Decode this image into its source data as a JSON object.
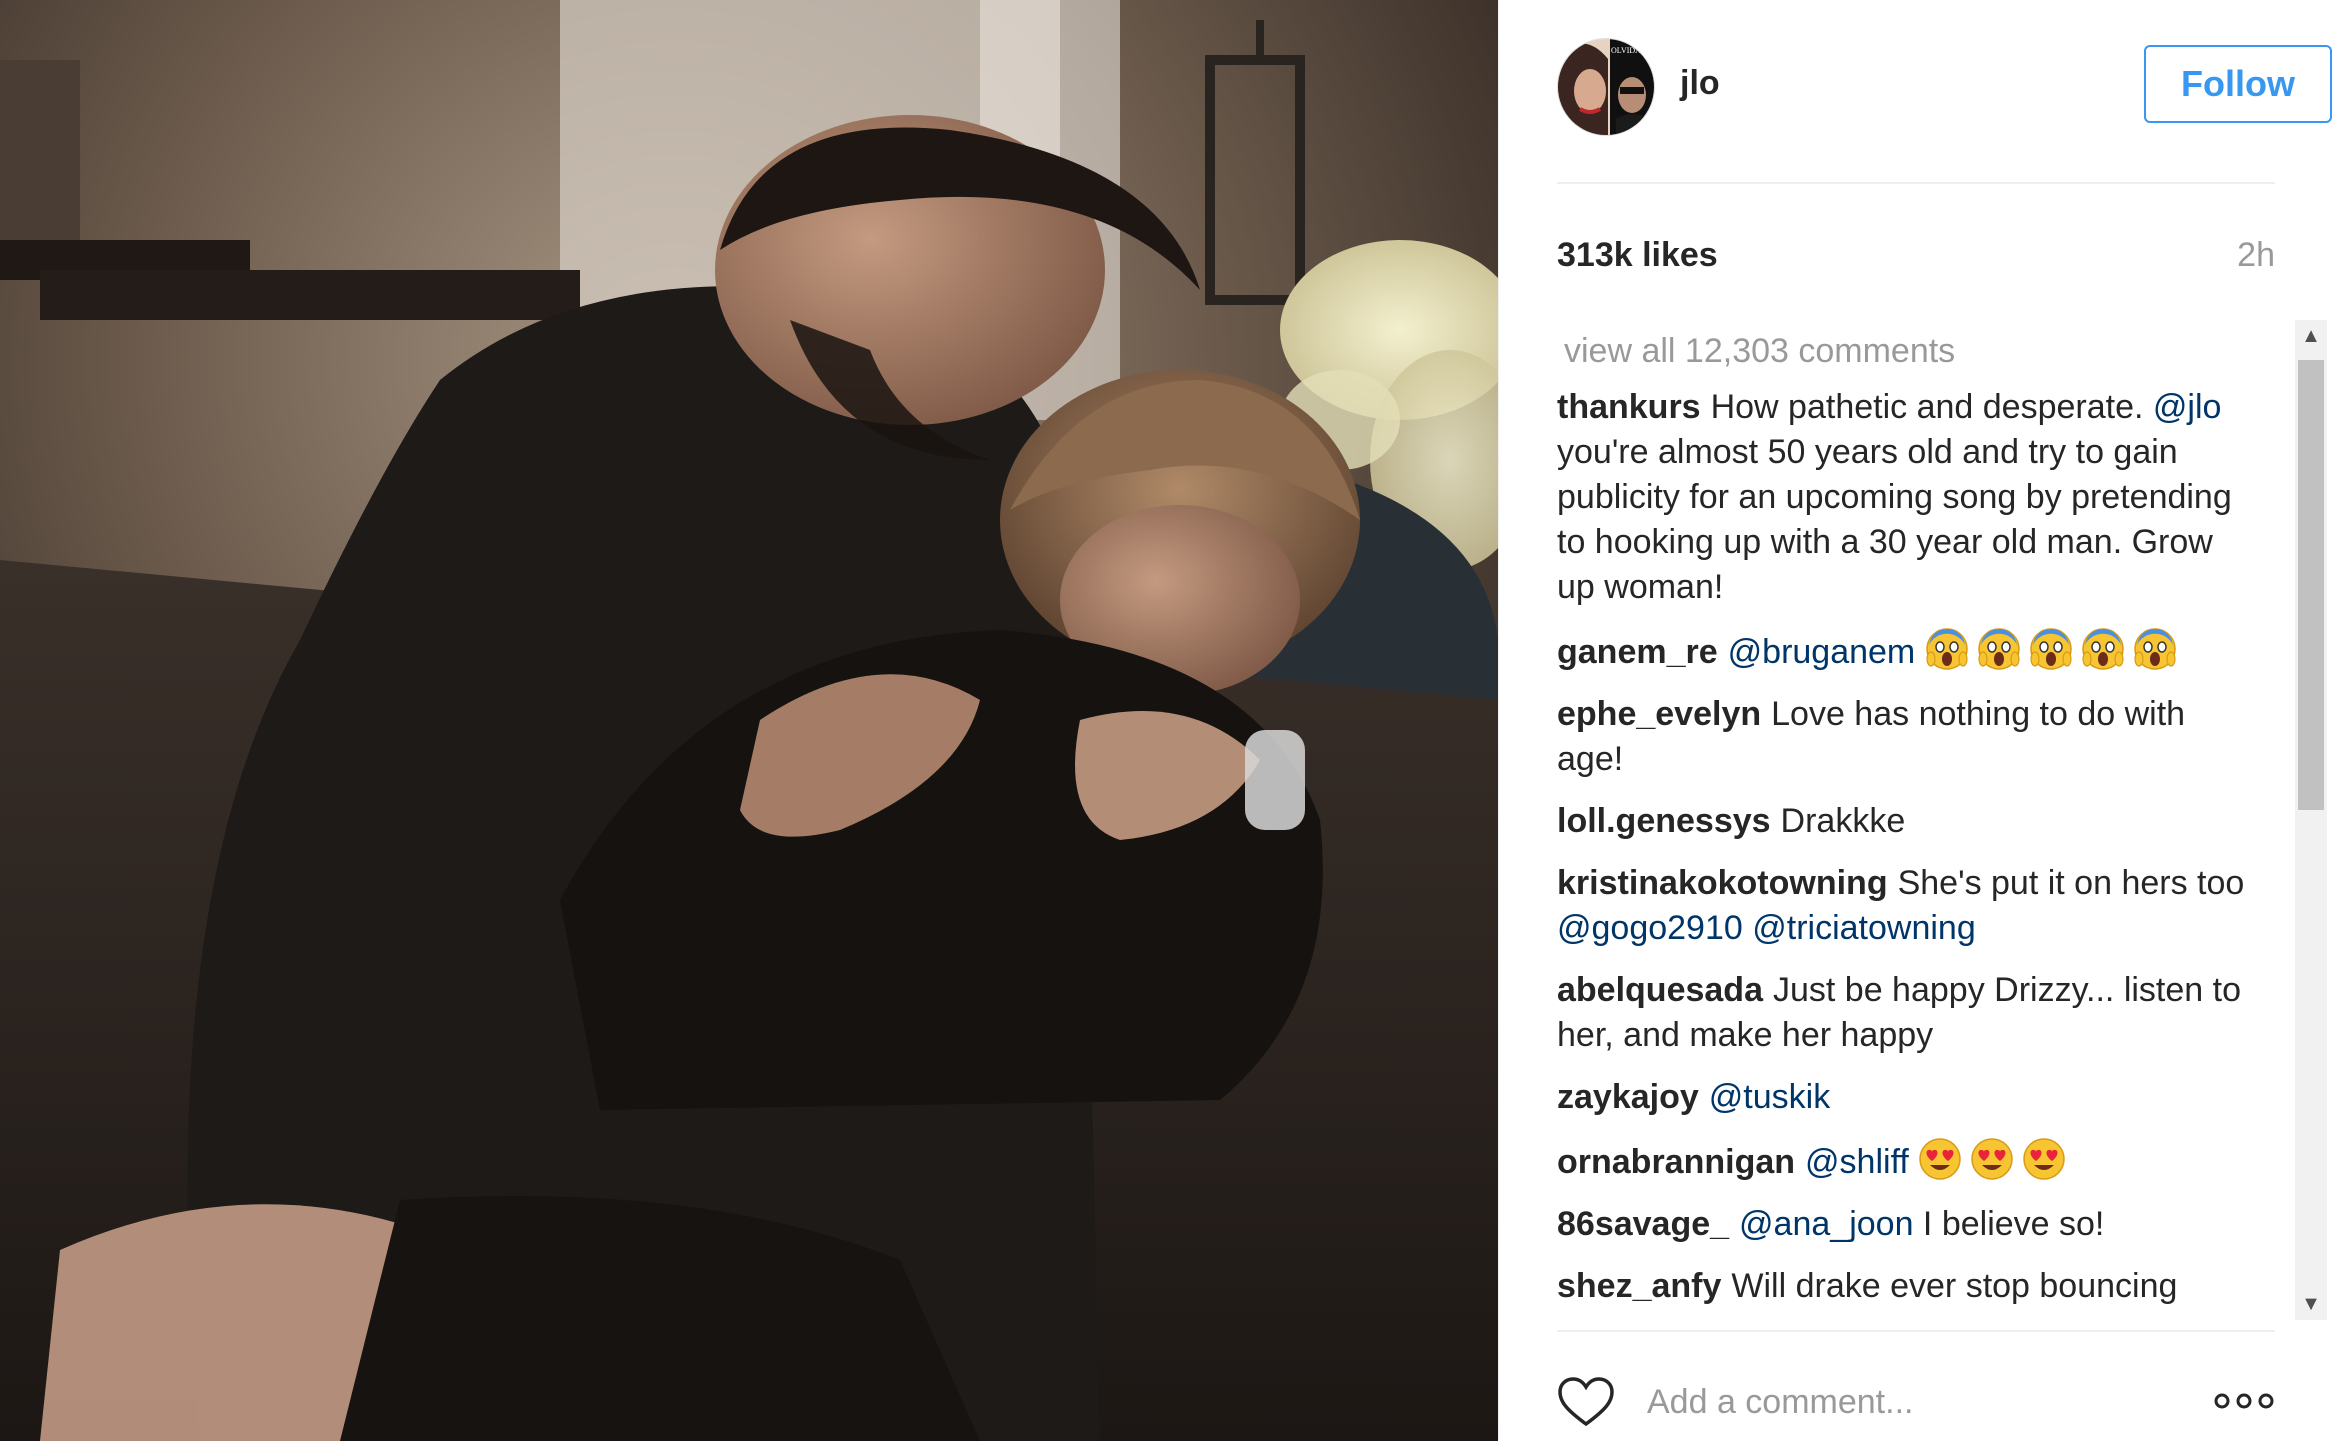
{
  "post": {
    "username": "jlo",
    "follow_label": "Follow",
    "likes": "313k likes",
    "time_ago": "2h",
    "view_all": "view all 12,303 comments",
    "add_comment_placeholder": "Add a comment...",
    "avatar_overlay_text": "OLVIDAME"
  },
  "comments": [
    {
      "user": "thankurs",
      "parts": [
        {
          "t": "text",
          "v": "How pathetic and desperate. "
        },
        {
          "t": "mention",
          "v": "@jlo"
        },
        {
          "t": "text",
          "v": " you're almost 50 years old and try to gain publicity for an upcoming song by pretending to hooking up with a 30 year old man. Grow up woman!"
        }
      ]
    },
    {
      "user": "ganem_re",
      "parts": [
        {
          "t": "mention",
          "v": "@bruganem"
        },
        {
          "t": "text",
          "v": " "
        },
        {
          "t": "emoji",
          "v": "scream"
        },
        {
          "t": "emoji",
          "v": "scream"
        },
        {
          "t": "emoji",
          "v": "scream"
        },
        {
          "t": "emoji",
          "v": "scream"
        },
        {
          "t": "emoji",
          "v": "scream"
        }
      ]
    },
    {
      "user": "ephe_evelyn",
      "parts": [
        {
          "t": "text",
          "v": "Love has nothing to do with age!"
        }
      ]
    },
    {
      "user": "loll.genessys",
      "parts": [
        {
          "t": "text",
          "v": "Drakkke"
        }
      ]
    },
    {
      "user": "kristinakokotowning",
      "parts": [
        {
          "t": "text",
          "v": "She's put it on hers too "
        },
        {
          "t": "mention",
          "v": "@gogo2910"
        },
        {
          "t": "text",
          "v": " "
        },
        {
          "t": "mention",
          "v": "@triciatowning"
        }
      ]
    },
    {
      "user": "abelquesada",
      "parts": [
        {
          "t": "text",
          "v": "Just be happy Drizzy... listen to her, and make her happy"
        }
      ]
    },
    {
      "user": "zaykajoy",
      "parts": [
        {
          "t": "mention",
          "v": "@tuskik"
        }
      ]
    },
    {
      "user": "ornabrannigan",
      "parts": [
        {
          "t": "mention",
          "v": "@shliff"
        },
        {
          "t": "text",
          "v": " "
        },
        {
          "t": "emoji",
          "v": "heart-eyes"
        },
        {
          "t": "emoji",
          "v": "heart-eyes"
        },
        {
          "t": "emoji",
          "v": "heart-eyes"
        }
      ]
    },
    {
      "user": "86savage_",
      "parts": [
        {
          "t": "mention",
          "v": "@ana_joon"
        },
        {
          "t": "text",
          "v": " I believe so!"
        }
      ]
    },
    {
      "user": "shez_anfy",
      "parts": [
        {
          "t": "text",
          "v": "Will drake ever stop bouncing"
        }
      ]
    }
  ],
  "icons": {
    "like": "heart-outline-icon",
    "more": "more-options-icon",
    "scroll_up": "scroll-up-arrow-icon",
    "scroll_down": "scroll-down-arrow-icon"
  },
  "colors": {
    "accent": "#3897f0",
    "mention": "#003569",
    "text": "#262626",
    "muted": "#999999",
    "divider": "#efefef"
  }
}
